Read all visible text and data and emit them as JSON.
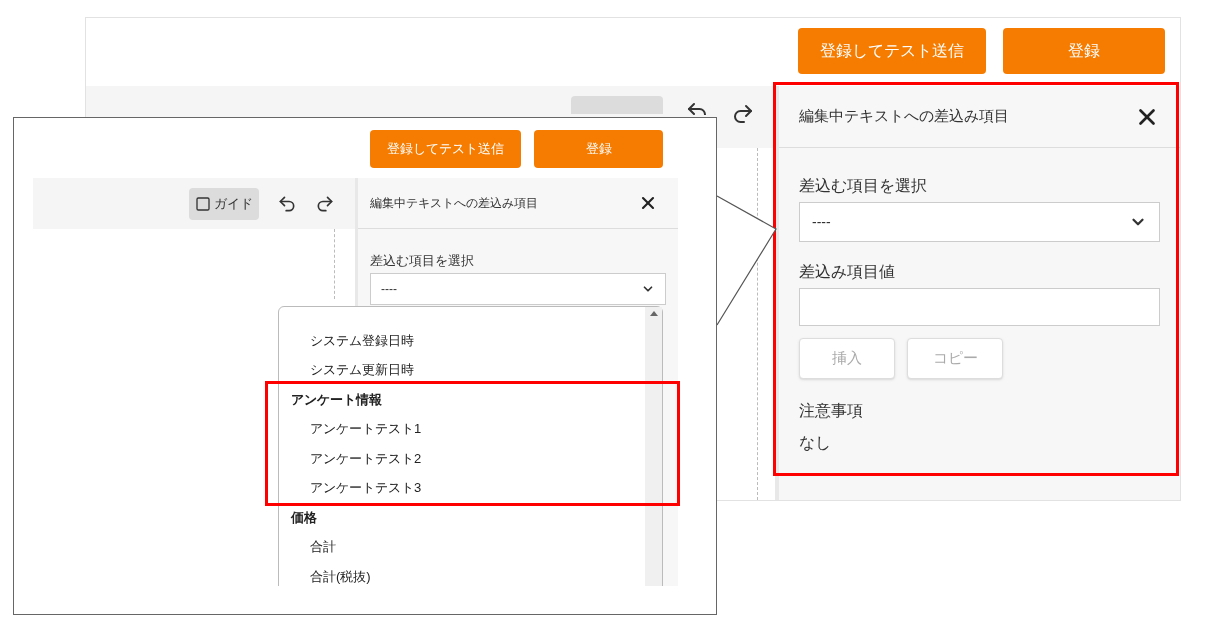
{
  "back_screen": {
    "buttons": [
      {
        "label": "登録してテスト送信"
      },
      {
        "label": "登録"
      }
    ],
    "panel": {
      "title": "編集中テキストへの差込み項目",
      "select_label": "差込む項目を選択",
      "select_value": "----",
      "value_label": "差込み項目値",
      "actions": [
        {
          "label": "挿入",
          "disabled": true
        },
        {
          "label": "コピー",
          "disabled": true
        }
      ],
      "notes_label": "注意事項",
      "notes": "なし"
    }
  },
  "zoom_callout": {
    "buttons": [
      {
        "label": "登録してテスト送信"
      },
      {
        "label": "登録"
      }
    ],
    "guide": {
      "label": "ガイド",
      "checked": false
    },
    "panel": {
      "title": "編集中テキストへの差込み項目",
      "select_label": "差込む項目を選択",
      "select_value": "----"
    },
    "dropdown": [
      {
        "kind": "option",
        "label": "システム登録日時"
      },
      {
        "kind": "option",
        "label": "システム更新日時"
      },
      {
        "kind": "group",
        "label": "アンケート情報"
      },
      {
        "kind": "option",
        "label": "アンケートテスト1"
      },
      {
        "kind": "option",
        "label": "アンケートテスト2"
      },
      {
        "kind": "option",
        "label": "アンケートテスト3"
      },
      {
        "kind": "group",
        "label": "価格"
      },
      {
        "kind": "option",
        "label": "合計"
      },
      {
        "kind": "option",
        "label": "合計(税抜)"
      }
    ]
  }
}
